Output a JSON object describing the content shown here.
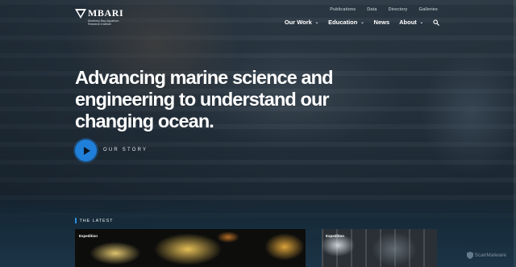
{
  "brand": {
    "name": "MBARI",
    "subtitle_line1": "Monterey Bay Aquarium",
    "subtitle_line2": "Research Institute"
  },
  "utility_nav": [
    "Publications",
    "Data",
    "Directory",
    "Galleries"
  ],
  "main_nav": [
    {
      "label": "Our Work",
      "dropdown": true
    },
    {
      "label": "Education",
      "dropdown": true
    },
    {
      "label": "News",
      "dropdown": false
    },
    {
      "label": "About",
      "dropdown": true
    }
  ],
  "caret": "⌄",
  "hero": {
    "headline": "Advancing marine science and engineering to understand our changing ocean.",
    "story_label": "OUR STORY"
  },
  "latest": {
    "label": "THE LATEST",
    "cards": [
      {
        "tag": "Expedition"
      },
      {
        "tag": "Expedition"
      }
    ]
  },
  "watermark": {
    "text": "ScanMalware"
  },
  "colors": {
    "accent": "#1f7fd9",
    "latest_bar": "#2c8be0"
  },
  "icons": {
    "search": "search-icon",
    "play": "play-icon",
    "logo": "logo-mark-icon",
    "watermark": "shield-icon"
  }
}
